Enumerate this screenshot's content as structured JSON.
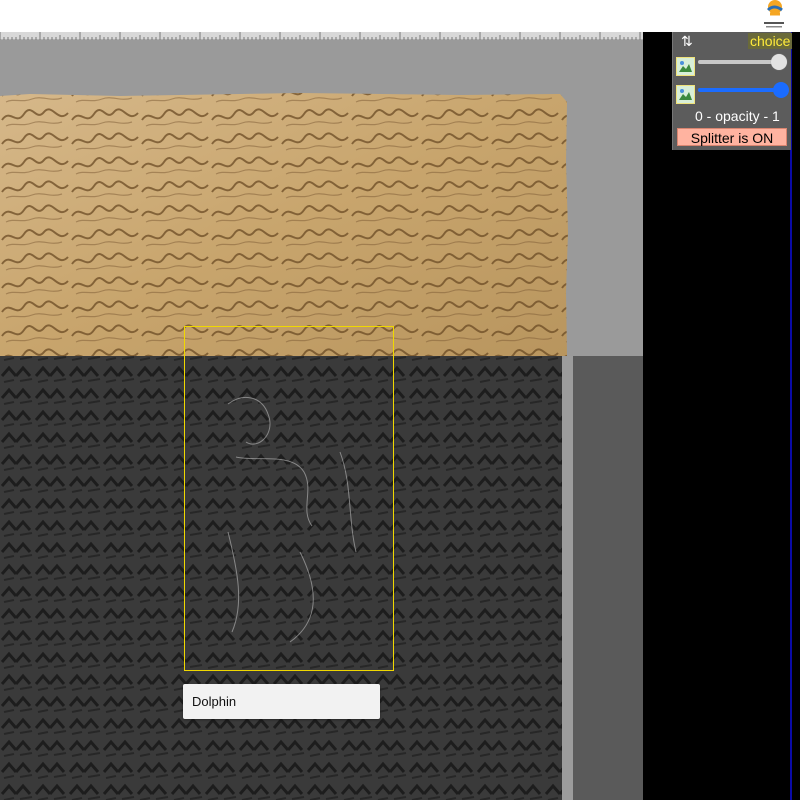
{
  "toolbar": {
    "swap_icon": "⇅",
    "choice_label": "choice",
    "layer_a_slider": 1.0,
    "layer_b_slider": 1.0,
    "opacity_label": "0 - opacity - 1",
    "splitter_label": "Splitter is ON"
  },
  "annotation": {
    "label": "Dolphin"
  },
  "colors": {
    "highlight": "#f0d800",
    "choice_text": "#ffeb3b",
    "slider_active": "#1b6cff",
    "splitter_bg": "#ffb3a0",
    "parchment": "#c9a870",
    "panel_bg": "#5c5c5c"
  },
  "icons": [
    "logo-icon",
    "swap-icon",
    "layer-image-icon"
  ]
}
